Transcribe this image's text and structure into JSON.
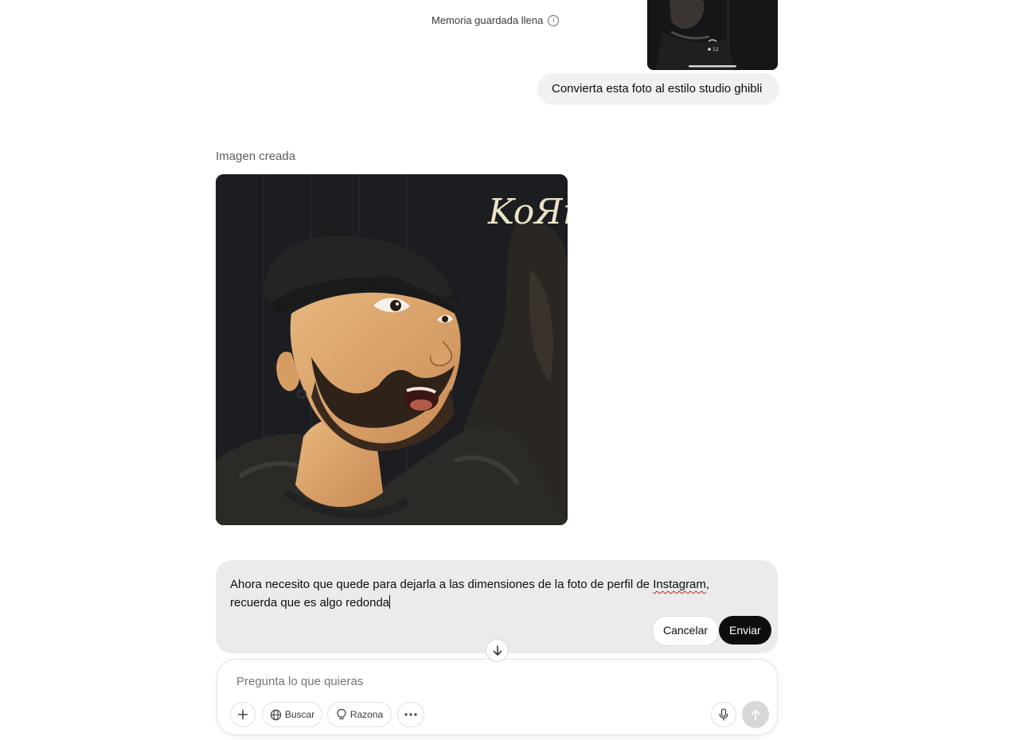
{
  "memory_notice": {
    "text": "Memoria guardada llena",
    "icon": "info-icon"
  },
  "uploaded_photo": {
    "overlay_counter": "12"
  },
  "user_message": {
    "text": "Convierta esta foto al estilo studio ghibli"
  },
  "assistant": {
    "created_label": "Imagen creada",
    "image_logo_text": "KoЯn"
  },
  "edit": {
    "text_before": "Ahora necesito que quede para dejarla a las dimensiones de la foto de perfil de ",
    "text_flagged": "Instagram",
    "text_after": ", recuerda que es algo redonda",
    "cancel_label": "Cancelar",
    "send_label": "Enviar"
  },
  "composer": {
    "placeholder": "Pregunta lo que quieras",
    "tools": [
      {
        "icon": "plus-icon",
        "label": ""
      },
      {
        "icon": "globe-icon",
        "label": "Buscar"
      },
      {
        "icon": "lightbulb-icon",
        "label": "Razona"
      },
      {
        "icon": "more-icon",
        "label": ""
      }
    ],
    "mic_icon": "microphone-icon",
    "send_icon": "arrow-up-icon"
  },
  "colors": {
    "send_button": "#0d0d0d",
    "edit_bg": "#ebebeb",
    "bubble_bg": "#f1f1f1"
  }
}
